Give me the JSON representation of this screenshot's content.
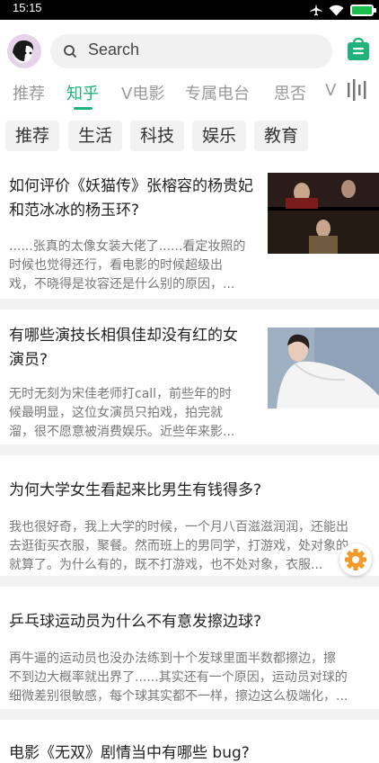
{
  "status_bar": {
    "time": "15:15"
  },
  "header": {
    "search": {
      "placeholder": "Search"
    }
  },
  "tabs": [
    {
      "label": "推荐",
      "active": false
    },
    {
      "label": "知乎",
      "active": true
    },
    {
      "label": "V电影",
      "active": false
    },
    {
      "label": "专属电台",
      "active": false
    },
    {
      "label": "思否",
      "active": false
    },
    {
      "label": "V",
      "active": false
    }
  ],
  "chips": [
    "推荐",
    "生活",
    "科技",
    "娱乐",
    "教育"
  ],
  "feed": [
    {
      "title_lines": [
        "如何评价《妖猫传》张榕容的杨贵妃",
        "和范冰冰的杨玉环?"
      ],
      "excerpt_lines": [
        "......张真的太像女装大佬了......看定妆照的",
        "时候也觉得还行，看电影的时候超级出",
        "戏，不晓得是妆容还是什么别的原因，..."
      ],
      "has_image": true
    },
    {
      "title_lines": [
        "有哪些演技长相俱佳却没有红的女",
        "演员?"
      ],
      "excerpt_lines": [
        "无时无刻为宋佳老师打call，前些年的时",
        "候最明显，这位女演员只拍戏，拍完就",
        "溜，很不愿意被消费娱乐。近些年来影..."
      ],
      "has_image": true
    },
    {
      "title_lines": [
        "为何大学女生看起来比男生有钱得多?"
      ],
      "excerpt_lines": [
        "我也很好奇，我上大学的时候，一个月八百滋滋润润，还能出",
        "去逛街买衣服，聚餐。然而班上的男同学，打游戏，处对象的",
        "就算了。为什么有的，既不打游戏，也不处对象，衣服..."
      ],
      "has_image": false
    },
    {
      "title_lines": [
        "乒乓球运动员为什么不有意发擦边球?"
      ],
      "excerpt_lines": [
        "再牛逼的运动员也没办法练到十个发球里面半数都擦边，擦",
        "不到边大概率就出界了......其实还有一个原因，运动员对球的",
        "细微差别很敏感，每个球其实都不一样，擦边这么极端化，..."
      ],
      "has_image": false
    },
    {
      "title_lines": [
        "电影《无双》剧情当中有哪些 bug?"
      ],
      "excerpt_lines": [],
      "has_image": false
    }
  ],
  "colors": {
    "accent": "#1fb37a",
    "battery": "#1cbf4b"
  }
}
